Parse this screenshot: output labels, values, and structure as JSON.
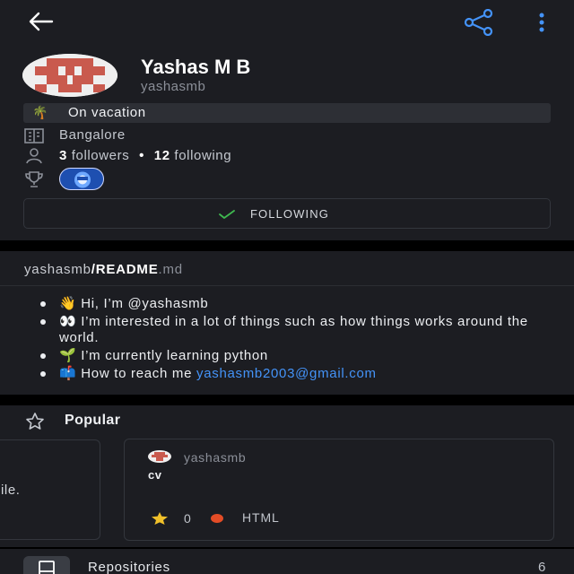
{
  "header": {
    "back_icon": "arrow-left-icon",
    "share_icon": "share-icon",
    "more_icon": "kebab-menu-icon",
    "accent_color": "#4493f8"
  },
  "profile": {
    "name": "Yashas M B",
    "login": "yashasmb",
    "status_emoji": "🌴",
    "status": "On vacation",
    "location": "Bangalore",
    "followers_count": "3",
    "followers_label": "followers",
    "separator": "•",
    "following_count": "12",
    "following_label": "following",
    "follow_button": "FOLLOWING",
    "follow_check_color": "#3fb950"
  },
  "readme": {
    "owner": "yashasmb",
    "slash": "/",
    "file": "README",
    "ext": ".md",
    "items": [
      "👋 Hi, I’m @yashasmb",
      "👀 I’m interested in a lot of things such as how things works around the world.",
      "🌱 I’m currently learning python"
    ],
    "contact_prefix": "📫 How to reach me ",
    "contact_email": "yashasmb2003@gmail.com"
  },
  "popular": {
    "title": "Popular",
    "left_card_fragment": "ile.",
    "card": {
      "owner": "yashasmb",
      "repo": "cv",
      "stars": "0",
      "language": "HTML",
      "language_color": "#e34c26"
    }
  },
  "repositories": {
    "label": "Repositories",
    "count": "6"
  }
}
